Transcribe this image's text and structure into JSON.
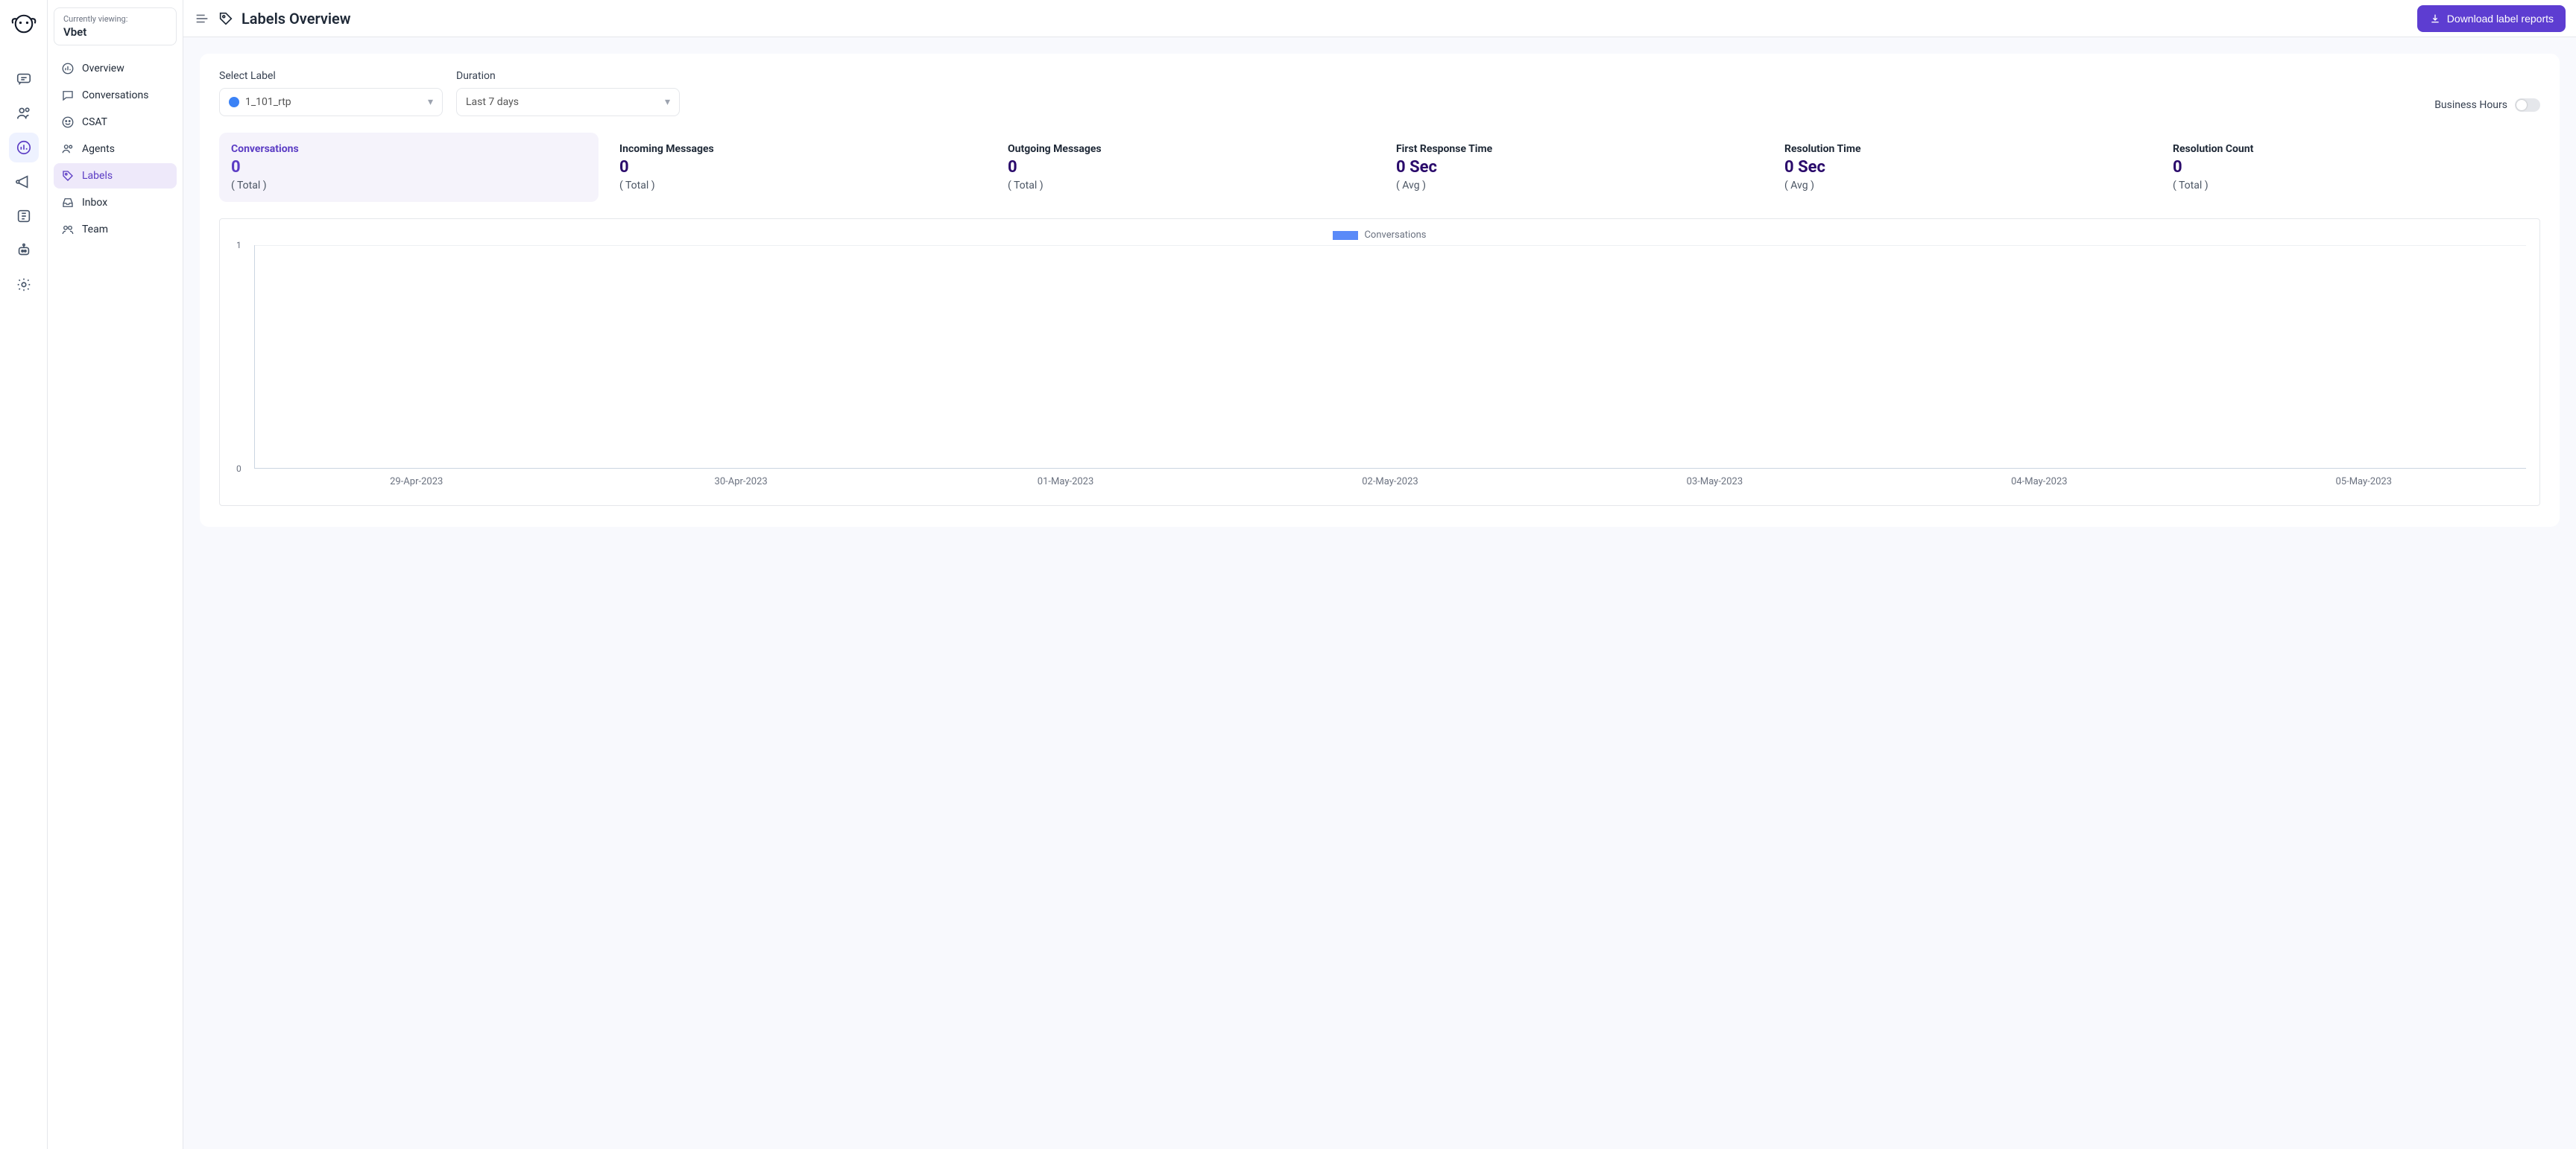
{
  "org": {
    "viewing_label": "Currently viewing:",
    "name": "Vbet"
  },
  "sidebar": {
    "items": [
      {
        "label": "Overview"
      },
      {
        "label": "Conversations"
      },
      {
        "label": "CSAT"
      },
      {
        "label": "Agents"
      },
      {
        "label": "Labels"
      },
      {
        "label": "Inbox"
      },
      {
        "label": "Team"
      }
    ]
  },
  "header": {
    "title": "Labels Overview",
    "download_btn": "Download label reports"
  },
  "filters": {
    "label_field_label": "Select Label",
    "label_value": "1_101_rtp",
    "duration_field_label": "Duration",
    "duration_value": "Last 7 days",
    "business_hours_label": "Business Hours"
  },
  "stats": [
    {
      "title": "Conversations",
      "value": "0",
      "sub": "( Total )"
    },
    {
      "title": "Incoming Messages",
      "value": "0",
      "sub": "( Total )"
    },
    {
      "title": "Outgoing Messages",
      "value": "0",
      "sub": "( Total )"
    },
    {
      "title": "First Response Time",
      "value": "0 Sec",
      "sub": "( Avg )"
    },
    {
      "title": "Resolution Time",
      "value": "0 Sec",
      "sub": "( Avg )"
    },
    {
      "title": "Resolution Count",
      "value": "0",
      "sub": "( Total )"
    }
  ],
  "chart_data": {
    "type": "bar",
    "title": "",
    "legend_label": "Conversations",
    "categories": [
      "29-Apr-2023",
      "30-Apr-2023",
      "01-May-2023",
      "02-May-2023",
      "03-May-2023",
      "04-May-2023",
      "05-May-2023"
    ],
    "values": [
      0,
      0,
      0,
      0,
      0,
      0,
      0
    ],
    "ylabel": "",
    "xlabel": "",
    "ylim": [
      0,
      1
    ],
    "yticks": [
      "0",
      "1"
    ]
  }
}
